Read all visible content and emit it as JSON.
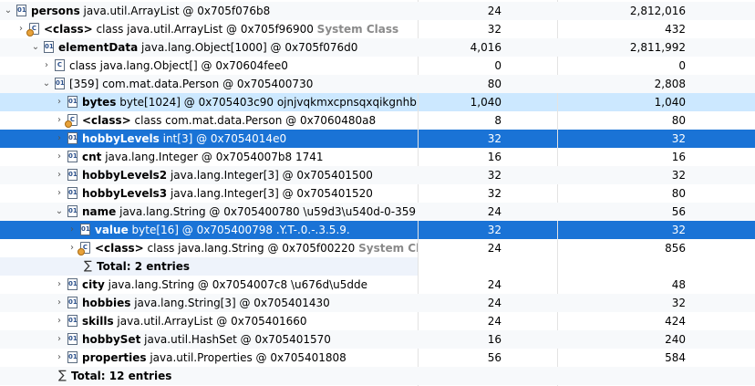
{
  "rows": [
    {
      "tw": "⌄",
      "icon": "D",
      "name": "persons",
      "rest": " java.util.ArrayList @ 0x705f076b8",
      "sys": "",
      "shallow": "24",
      "retained": "2,812,016",
      "style": "stripe"
    },
    {
      "tw": "›",
      "icon": "cls",
      "name": "<class>",
      "rest": " class java.util.ArrayList @ 0x705f96900 ",
      "sys": "System Class",
      "shallow": "32",
      "retained": "432",
      "style": ""
    },
    {
      "tw": "⌄",
      "icon": "D",
      "name": "elementData",
      "rest": " java.lang.Object[1000] @ 0x705f076d0",
      "sys": "",
      "shallow": "4,016",
      "retained": "2,811,992",
      "style": "stripe"
    },
    {
      "tw": "›",
      "icon": "C",
      "name": "",
      "rest": "class java.lang.Object[] @ 0x70604fee0",
      "sys": "",
      "shallow": "0",
      "retained": "0",
      "style": ""
    },
    {
      "tw": "⌄",
      "icon": "D",
      "name": "",
      "rest": "[359] com.mat.data.Person @ 0x705400730",
      "sys": "",
      "shallow": "80",
      "retained": "2,808",
      "style": "stripe"
    },
    {
      "tw": "›",
      "icon": "D",
      "name": "bytes",
      "rest": " byte[1024] @ 0x705403c90  ojnjvqkmxcpnsqxqikgnhb",
      "sys": "",
      "shallow": "1,040",
      "retained": "1,040",
      "style": "sel-light"
    },
    {
      "tw": "›",
      "icon": "cls",
      "name": "<class>",
      "rest": " class com.mat.data.Person @ 0x7060480a8",
      "sys": "",
      "shallow": "8",
      "retained": "80",
      "style": ""
    },
    {
      "tw": "›",
      "icon": "D",
      "name": "hobbyLevels",
      "rest": " int[3] @ 0x7054014e0",
      "sys": "",
      "shallow": "32",
      "retained": "32",
      "style": "sel-dark"
    },
    {
      "tw": "›",
      "icon": "D",
      "name": "cnt",
      "rest": " java.lang.Integer @ 0x7054007b8  1741",
      "sys": "",
      "shallow": "16",
      "retained": "16",
      "style": ""
    },
    {
      "tw": "›",
      "icon": "D",
      "name": "hobbyLevels2",
      "rest": " java.lang.Integer[3] @ 0x705401500",
      "sys": "",
      "shallow": "32",
      "retained": "32",
      "style": "stripe"
    },
    {
      "tw": "›",
      "icon": "D",
      "name": "hobbyLevels3",
      "rest": " java.lang.Integer[3] @ 0x705401520",
      "sys": "",
      "shallow": "32",
      "retained": "80",
      "style": ""
    },
    {
      "tw": "⌄",
      "icon": "D",
      "name": "name",
      "rest": " java.lang.String @ 0x705400780  \\u59d3\\u540d-0-359",
      "sys": "",
      "shallow": "24",
      "retained": "56",
      "style": "stripe"
    },
    {
      "tw": "›",
      "icon": "D",
      "name": "value",
      "rest": " byte[16] @ 0x705400798  .Y.T-.0.-.3.5.9.",
      "sys": "",
      "shallow": "32",
      "retained": "32",
      "style": "sel-dark"
    },
    {
      "tw": "›",
      "icon": "cls",
      "name": "<class>",
      "rest": " class java.lang.String @ 0x705f00220 ",
      "sys": "System Cla",
      "shallow": "24",
      "retained": "856",
      "style": ""
    },
    {
      "tw": "",
      "icon": "sigma",
      "name": "Total: 2 entries",
      "rest": "",
      "sys": "",
      "shallow": "",
      "retained": "",
      "style": "total"
    },
    {
      "tw": "›",
      "icon": "D",
      "name": "city",
      "rest": " java.lang.String @ 0x7054007c8  \\u676d\\u5dde",
      "sys": "",
      "shallow": "24",
      "retained": "48",
      "style": ""
    },
    {
      "tw": "›",
      "icon": "D",
      "name": "hobbies",
      "rest": " java.lang.String[3] @ 0x705401430",
      "sys": "",
      "shallow": "24",
      "retained": "32",
      "style": "stripe"
    },
    {
      "tw": "›",
      "icon": "D",
      "name": "skills",
      "rest": " java.util.ArrayList @ 0x705401660",
      "sys": "",
      "shallow": "24",
      "retained": "424",
      "style": ""
    },
    {
      "tw": "›",
      "icon": "D",
      "name": "hobbySet",
      "rest": " java.util.HashSet @ 0x705401570",
      "sys": "",
      "shallow": "16",
      "retained": "240",
      "style": "stripe"
    },
    {
      "tw": "›",
      "icon": "D",
      "name": "properties",
      "rest": " java.util.Properties @ 0x705401808",
      "sys": "",
      "shallow": "56",
      "retained": "584",
      "style": ""
    },
    {
      "tw": "",
      "icon": "sigma",
      "name": "Total: 12 entries",
      "rest": "",
      "sys": "",
      "shallow": "",
      "retained": "",
      "style": "stripe"
    }
  ]
}
